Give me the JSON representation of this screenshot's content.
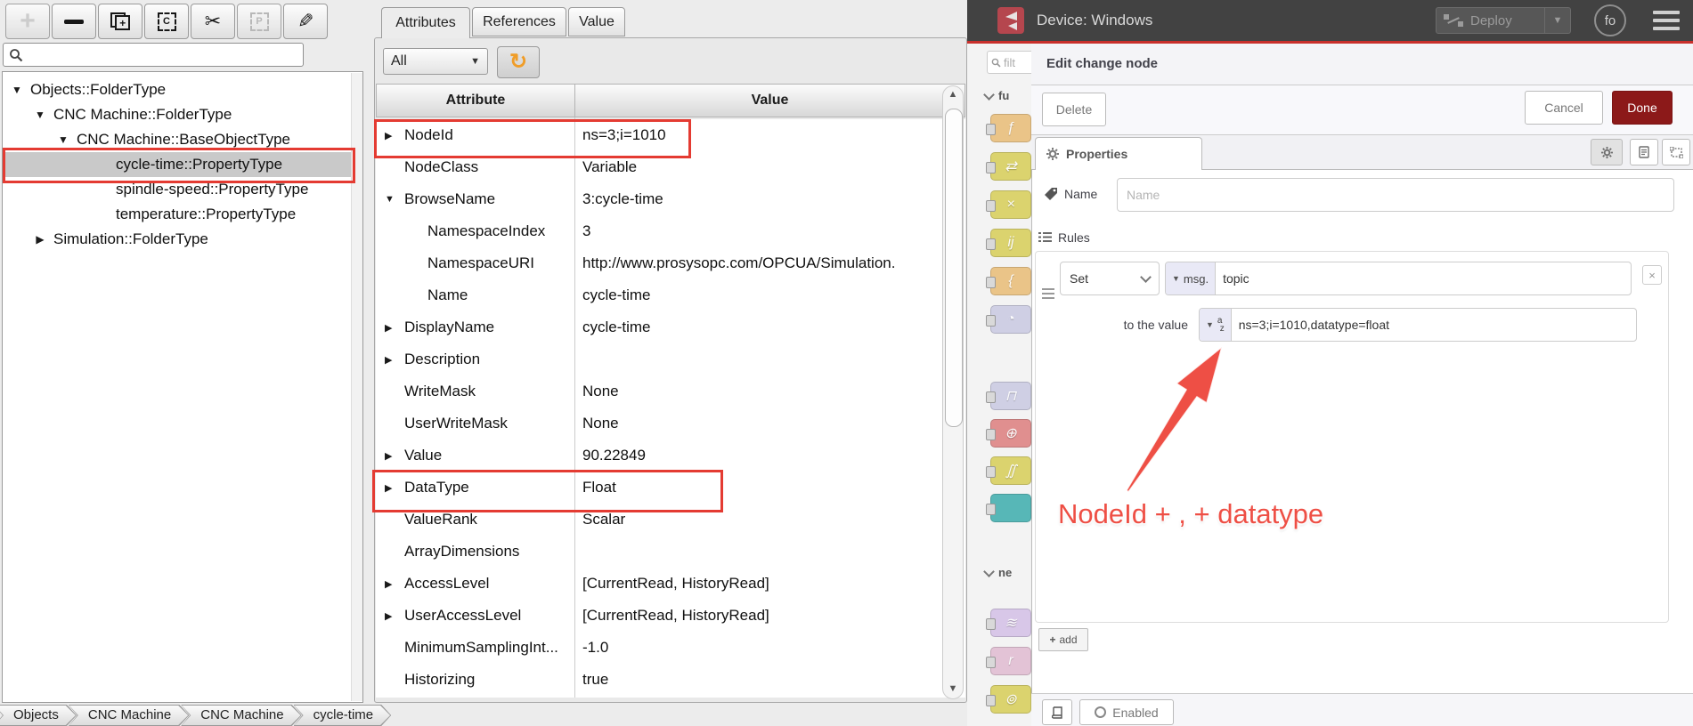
{
  "opcua": {
    "toolbar": [
      {
        "icon": "add-icon",
        "disabled": true
      },
      {
        "icon": "remove-icon",
        "disabled": false
      },
      {
        "icon": "new-window-icon",
        "disabled": false
      },
      {
        "icon": "copy-icon",
        "label": "C",
        "disabled": false
      },
      {
        "icon": "cut-icon",
        "disabled": false
      },
      {
        "icon": "paste-icon",
        "label": "P",
        "disabled": true
      },
      {
        "icon": "edit-icon",
        "disabled": false
      }
    ],
    "search": {
      "value": ""
    },
    "tree": {
      "items": [
        {
          "indent": 8,
          "arrow": "▼",
          "icon": "folder",
          "label": "Objects::FolderType",
          "selected": false
        },
        {
          "indent": 34,
          "arrow": "▼",
          "icon": "folder",
          "label": "CNC Machine::FolderType",
          "selected": false
        },
        {
          "indent": 60,
          "arrow": "▼",
          "icon": "cube",
          "label": "CNC Machine::BaseObjectType",
          "selected": false
        },
        {
          "indent": 104,
          "arrow": "",
          "icon": "grid",
          "label": "cycle-time::PropertyType",
          "selected": true
        },
        {
          "indent": 104,
          "arrow": "",
          "icon": "grid",
          "label": "spindle-speed::PropertyType",
          "selected": false
        },
        {
          "indent": 104,
          "arrow": "",
          "icon": "grid",
          "label": "temperature::PropertyType",
          "selected": false
        },
        {
          "indent": 34,
          "arrow": "▶",
          "icon": "folder",
          "label": "Simulation::FolderType",
          "selected": false
        }
      ]
    },
    "tabs": [
      {
        "label": "Attributes",
        "active": true
      },
      {
        "label": "References",
        "active": false
      },
      {
        "label": "Value",
        "active": false
      }
    ],
    "filter": {
      "value": "All"
    },
    "table": {
      "columns": [
        "Attribute",
        "Value"
      ],
      "rows": [
        {
          "expander": "▶",
          "name": "NodeId",
          "value": "ns=3;i=1010",
          "child": false
        },
        {
          "expander": "",
          "name": "NodeClass",
          "value": "Variable",
          "child": false
        },
        {
          "expander": "▼",
          "name": "BrowseName",
          "value": "3:cycle-time",
          "child": false
        },
        {
          "expander": "",
          "name": "NamespaceIndex",
          "value": "3",
          "child": true
        },
        {
          "expander": "",
          "name": "NamespaceURI",
          "value": "http://www.prosysopc.com/OPCUA/Simulation.",
          "child": true
        },
        {
          "expander": "",
          "name": "Name",
          "value": "cycle-time",
          "child": true
        },
        {
          "expander": "▶",
          "name": "DisplayName",
          "value": "cycle-time",
          "child": false
        },
        {
          "expander": "▶",
          "name": "Description",
          "value": "",
          "child": false
        },
        {
          "expander": "",
          "name": "WriteMask",
          "value": "None",
          "child": false
        },
        {
          "expander": "",
          "name": "UserWriteMask",
          "value": "None",
          "child": false
        },
        {
          "expander": "▶",
          "name": "Value",
          "value": "90.22849",
          "child": false
        },
        {
          "expander": "▶",
          "name": "DataType",
          "value": "Float",
          "child": false
        },
        {
          "expander": "",
          "name": "ValueRank",
          "value": "Scalar",
          "child": false
        },
        {
          "expander": "",
          "name": "ArrayDimensions",
          "value": "",
          "child": false
        },
        {
          "expander": "▶",
          "name": "AccessLevel",
          "value": "[CurrentRead, HistoryRead]",
          "child": false
        },
        {
          "expander": "▶",
          "name": "UserAccessLevel",
          "value": "[CurrentRead, HistoryRead]",
          "child": false
        },
        {
          "expander": "",
          "name": "MinimumSamplingInt...",
          "value": "-1.0",
          "child": false
        },
        {
          "expander": "",
          "name": "Historizing",
          "value": "true",
          "child": false
        }
      ]
    },
    "breadcrumb": [
      {
        "label": "Objects"
      },
      {
        "label": "CNC Machine"
      },
      {
        "label": "CNC Machine"
      },
      {
        "label": "cycle-time"
      }
    ]
  },
  "nodered": {
    "header": {
      "title": "Device: Windows",
      "deploy_label": "Deploy",
      "avatar": "fo"
    },
    "palette": {
      "search_placeholder": "filt",
      "category_function": "fu",
      "category_network": "ne",
      "nodes": [
        {
          "name": "function-node",
          "glyph": "ƒ",
          "color": "#eac488",
          "top": "128"
        },
        {
          "name": "switch-node",
          "glyph": "⇄",
          "color": "#dbd36e",
          "top": "171"
        },
        {
          "name": "change-node",
          "glyph": "×",
          "color": "#dbd36e",
          "top": "214"
        },
        {
          "name": "range-node",
          "glyph": "ij",
          "color": "#dbd36e",
          "top": "257"
        },
        {
          "name": "template-node",
          "glyph": "{",
          "color": "#eac488",
          "top": "300"
        },
        {
          "name": "delay-node",
          "glyph": "◔",
          "color": "#cfcfe4",
          "top": "343"
        },
        {
          "name": "trigger-node",
          "glyph": "⊓",
          "color": "#cfcfe4",
          "top": "429"
        },
        {
          "name": "exec-node",
          "glyph": "⊕",
          "color": "#e08f8f",
          "top": "471"
        },
        {
          "name": "filter-node",
          "glyph": "∬",
          "color": "#dbd36e",
          "top": "513"
        },
        {
          "name": "status-node",
          "glyph": "",
          "color": "#57b7b7",
          "top": "555"
        },
        {
          "name": "mqtt-node",
          "glyph": "≋",
          "color": "#d8c7e8",
          "top": "684"
        },
        {
          "name": "http-node",
          "glyph": "r",
          "color": "#e3c3d6",
          "top": "727"
        },
        {
          "name": "websocket-node",
          "glyph": "⊚",
          "color": "#dbd36e",
          "top": "770"
        }
      ]
    },
    "tray": {
      "title": "Edit change node",
      "delete_label": "Delete",
      "cancel_label": "Cancel",
      "done_label": "Done",
      "tab_properties": "Properties",
      "name_label": "Name",
      "name_placeholder": "Name",
      "rules_label": "Rules",
      "rule": {
        "action": "Set",
        "property_prefix": "msg.",
        "property_value": "topic",
        "to_label": "to the value",
        "value": "ns=3;i=1010,datatype=float",
        "remove_label": "×"
      },
      "add_label": "add",
      "enabled_label": "Enabled"
    }
  },
  "annotation": {
    "text": "NodeId + , + datatype",
    "color": "#ee4f45",
    "highlighted_items": [
      "cycle-time::PropertyType tree row",
      "NodeId attribute row",
      "DataType attribute row"
    ]
  },
  "colors": {
    "accent_red": "#c9302c",
    "done_button": "#8C1919",
    "folder_orange": "#F5A31A",
    "refresh_orange": "#f09d28",
    "highlight_box": "#e43b32",
    "nodered_header": "#424242"
  }
}
